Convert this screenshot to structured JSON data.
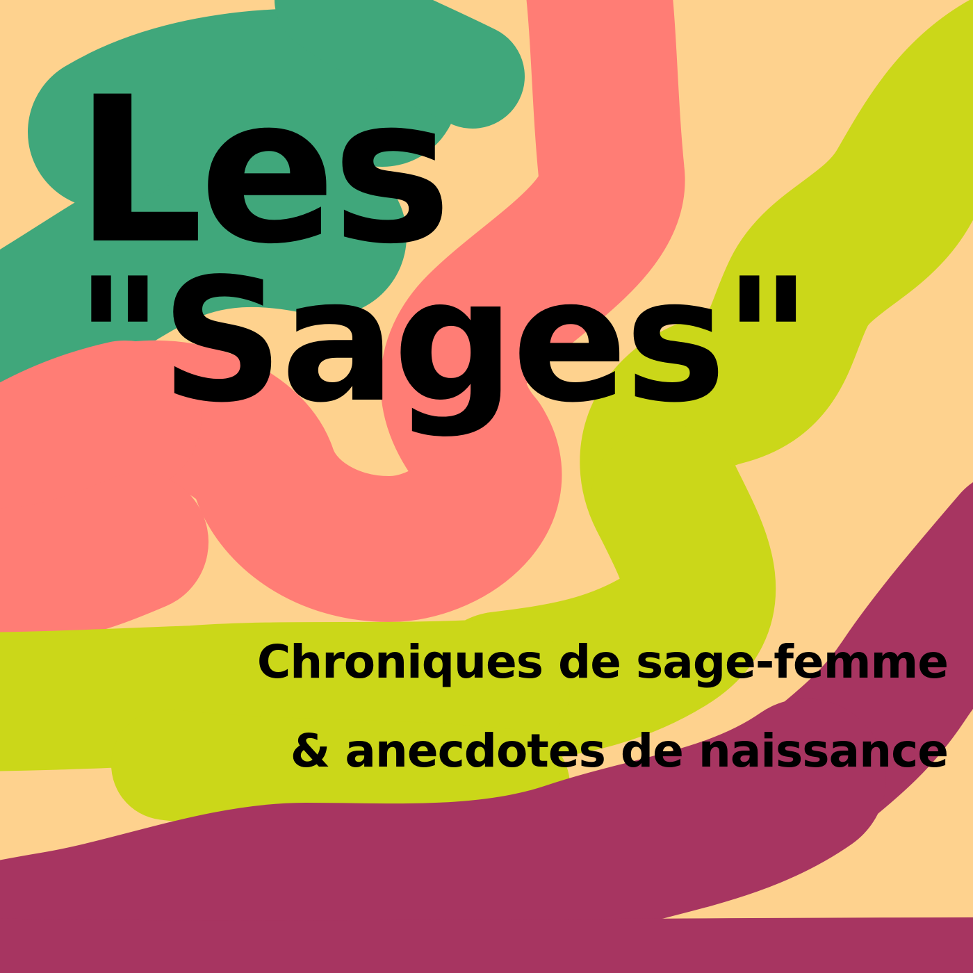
{
  "cover": {
    "title_line1": "Les",
    "title_line2": "\"Sages\"",
    "subtitle_line1": "Chroniques de sage-femme",
    "subtitle_line2": "& anecdotes de naissance"
  },
  "colors": {
    "background": "#fed28e",
    "green": "#40a77b",
    "coral": "#ff7d75",
    "lime": "#cbd719",
    "plum": "#a73561",
    "text": "#000000"
  }
}
